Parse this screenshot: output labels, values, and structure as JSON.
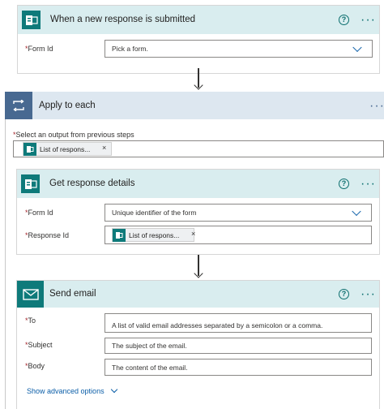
{
  "trigger": {
    "title": "When a new response is submitted",
    "form_id_label": "Form Id",
    "form_id_value": "Pick a form."
  },
  "apply_to_each": {
    "title": "Apply to each",
    "select_label": "Select an output from previous steps",
    "token_label": "List of respons..."
  },
  "get_details": {
    "title": "Get response details",
    "form_id_label": "Form Id",
    "form_id_value": "Unique identifier of the form",
    "response_id_label": "Response Id",
    "token_label": "List of respons..."
  },
  "send_email": {
    "title": "Send email",
    "to_label": "To",
    "to_placeholder": "A list of valid email addresses separated by a semicolon or a comma.",
    "subject_label": "Subject",
    "subject_placeholder": "The subject of the email.",
    "body_label": "Body",
    "body_placeholder": "The content of the email.",
    "advanced_link": "Show advanced options"
  },
  "common": {
    "required_mark": "*",
    "help_glyph": "?",
    "more_glyph": "···",
    "remove_glyph": "×"
  },
  "colors": {
    "header_bg": "#d9edef",
    "icon_bg": "#0e7a7a",
    "loop_header_bg": "#dde7f0",
    "link": "#0b5ea8"
  }
}
